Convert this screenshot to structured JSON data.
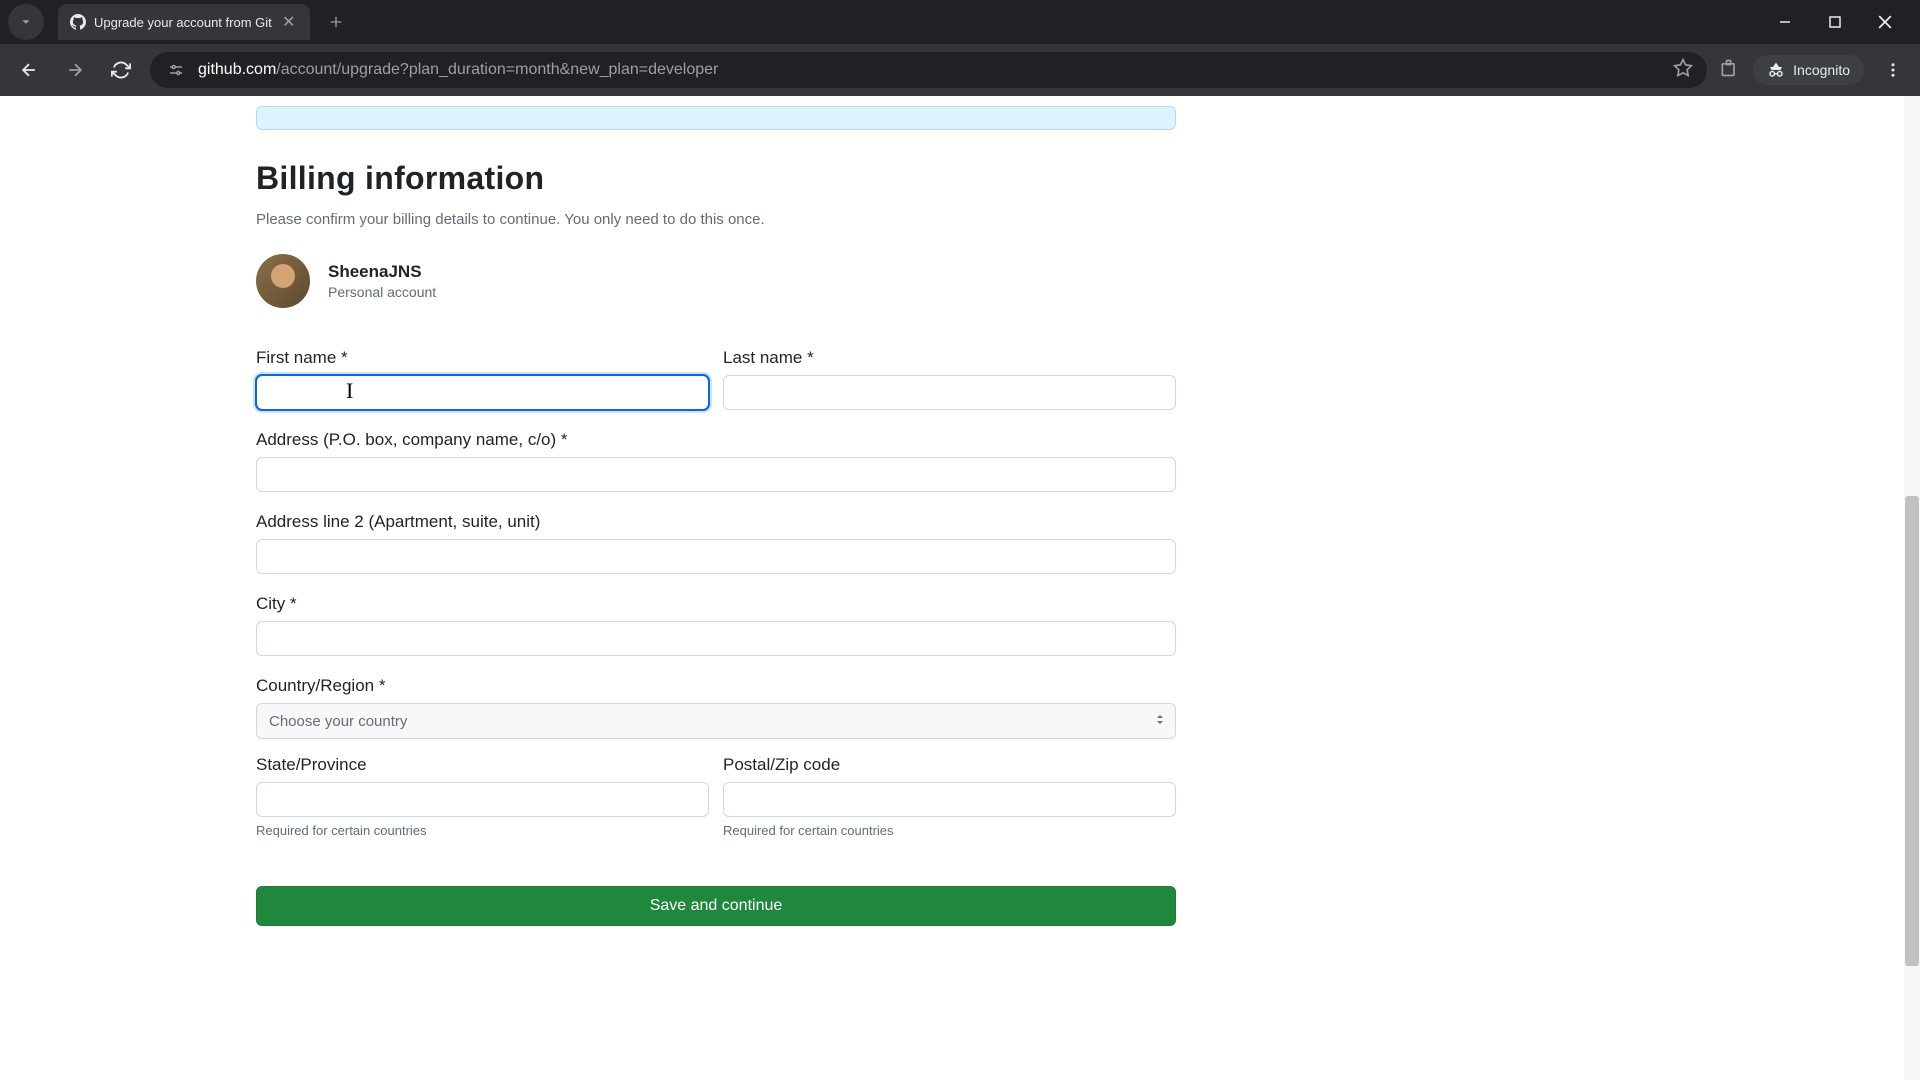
{
  "browser": {
    "tab_title": "Upgrade your account from Git",
    "url_domain": "github.com",
    "url_path": "/account/upgrade?plan_duration=month&new_plan=developer",
    "incognito_label": "Incognito"
  },
  "page": {
    "title": "Billing information",
    "subtitle": "Please confirm your billing details to continue. You only need to do this once.",
    "account": {
      "username": "SheenaJNS",
      "type": "Personal account"
    },
    "form": {
      "first_name_label": "First name *",
      "first_name_value": "",
      "last_name_label": "Last name *",
      "last_name_value": "",
      "address_label": "Address (P.O. box, company name, c/o) *",
      "address_value": "",
      "address2_label": "Address line 2 (Apartment, suite, unit)",
      "address2_value": "",
      "city_label": "City *",
      "city_value": "",
      "country_label": "Country/Region *",
      "country_placeholder": "Choose your country",
      "state_label": "State/Province",
      "state_value": "",
      "state_help": "Required for certain countries",
      "postal_label": "Postal/Zip code",
      "postal_value": "",
      "postal_help": "Required for certain countries",
      "submit_label": "Save and continue"
    }
  }
}
